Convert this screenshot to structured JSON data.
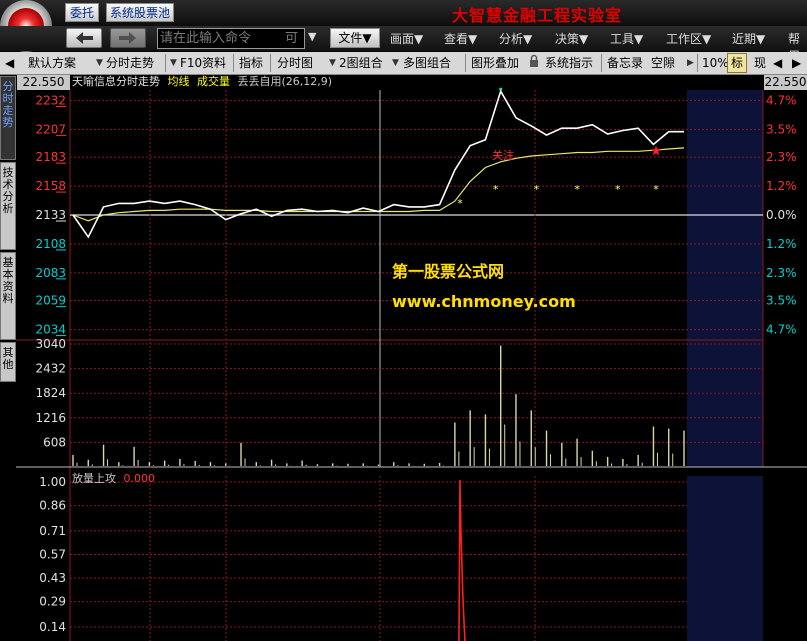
{
  "title_bar": {
    "entrust_label": "委托",
    "stock_pool_label": "系统股票池",
    "app_title": "大智慧金融工程实验室"
  },
  "menu_bar": {
    "command_placeholder": "请在此输入命令",
    "command_hint": "可",
    "items": [
      "文件▼",
      "画面▼",
      "查看▼",
      "分析▼",
      "决策▼",
      "工具▼",
      "工作区▼",
      "近期▼",
      "帮用"
    ]
  },
  "toolbar": {
    "items": [
      "默认方案",
      "分时走势",
      "F10资料",
      "指标",
      "分时图",
      "2图组合",
      "多图组合",
      "图形叠加",
      "系统指示",
      "备忘录",
      "空隙",
      "10%",
      "标",
      "现"
    ]
  },
  "side_tabs": [
    "分时走势",
    "技术分析",
    "基本资料",
    "其他"
  ],
  "chart_header": {
    "price_left": "22.550",
    "price_right": "22.550",
    "title": "天喻信息分时走势",
    "avg_label": "均线",
    "vol_label": "成交量",
    "indicator_label": "丢丢自用(26,12,9)",
    "annotation": "关注"
  },
  "watermark": {
    "line1": "第一股票公式网",
    "line2": "www.chnmoney.com"
  },
  "lower_panel": {
    "title": "放量上攻",
    "value": "0.000"
  },
  "colors": {
    "up": "#ff3232",
    "down": "#00d0d0",
    "price_line": "#ffffff",
    "avg_line": "#e8e870",
    "volume": "#d8d8a8",
    "signal": "#ff2020",
    "grid": "#8a1a1a",
    "future_zone": "#0c1238"
  },
  "chart_data": [
    {
      "type": "line",
      "name": "intraday",
      "prev_close": 21.33,
      "ylim": [
        20.25,
        22.41
      ],
      "y_ticks_left": [
        "2232",
        "2207",
        "2183",
        "2158",
        "2133",
        "2108",
        "2083",
        "2059",
        "2034"
      ],
      "y_ticks_right": [
        "4.7%",
        "3.5%",
        "2.3%",
        "1.2%",
        "0.0%",
        "1.2%",
        "2.3%",
        "3.5%",
        "4.7%"
      ],
      "x_minutes": [
        0,
        6,
        12,
        18,
        24,
        30,
        36,
        42,
        48,
        54,
        60,
        66,
        72,
        78,
        84,
        90,
        96,
        102,
        108,
        114,
        120,
        126,
        132,
        138,
        144,
        150,
        156,
        162,
        168,
        174,
        180,
        186,
        192,
        198,
        204,
        210,
        216,
        222,
        228,
        234,
        240
      ],
      "price": [
        21.33,
        21.14,
        21.4,
        21.43,
        21.43,
        21.45,
        21.43,
        21.45,
        21.42,
        21.38,
        21.29,
        21.34,
        21.38,
        21.32,
        21.37,
        21.38,
        21.36,
        21.37,
        21.35,
        21.39,
        21.36,
        21.42,
        21.4,
        21.4,
        21.42,
        21.72,
        21.93,
        21.98,
        22.4,
        22.17,
        22.1,
        22.02,
        22.08,
        22.08,
        22.11,
        22.03,
        22.06,
        22.08,
        21.94,
        22.05,
        22.05
      ],
      "avg": [
        21.33,
        21.28,
        21.33,
        21.35,
        21.36,
        21.37,
        21.37,
        21.38,
        21.38,
        21.38,
        21.37,
        21.37,
        21.37,
        21.36,
        21.36,
        21.36,
        21.36,
        21.36,
        21.36,
        21.36,
        21.36,
        21.36,
        21.36,
        21.37,
        21.37,
        21.45,
        21.62,
        21.74,
        21.79,
        21.82,
        21.84,
        21.85,
        21.86,
        21.87,
        21.87,
        21.88,
        21.88,
        21.88,
        21.89,
        21.9,
        21.91
      ],
      "star_minutes": [
        152,
        166,
        182,
        198,
        214,
        229
      ],
      "signal_minute": 229
    },
    {
      "type": "bar",
      "name": "volume",
      "y_ticks": [
        "3040",
        "2432",
        "1824",
        "1216",
        "608"
      ],
      "ylim": [
        0,
        3040
      ],
      "x_minutes": [
        0,
        6,
        12,
        18,
        24,
        30,
        36,
        42,
        48,
        54,
        60,
        66,
        72,
        78,
        84,
        90,
        96,
        102,
        108,
        114,
        120,
        126,
        132,
        138,
        144,
        150,
        156,
        162,
        168,
        174,
        180,
        186,
        192,
        198,
        204,
        210,
        216,
        222,
        228,
        234,
        240
      ],
      "values": [
        300,
        180,
        550,
        120,
        500,
        120,
        160,
        200,
        150,
        120,
        90,
        600,
        120,
        180,
        90,
        160,
        70,
        90,
        80,
        90,
        60,
        120,
        90,
        80,
        100,
        1100,
        1400,
        1300,
        3000,
        1800,
        1400,
        900,
        600,
        700,
        400,
        250,
        200,
        300,
        1000,
        950,
        900
      ]
    },
    {
      "type": "line",
      "name": "indicator",
      "title": "放量上攻",
      "y_ticks": [
        "1.00",
        "0.86",
        "0.71",
        "0.57",
        "0.43",
        "0.29",
        "0.14"
      ],
      "ylim": [
        0,
        1.0
      ],
      "spike_minute": 152,
      "spike_value": 1.0
    }
  ]
}
